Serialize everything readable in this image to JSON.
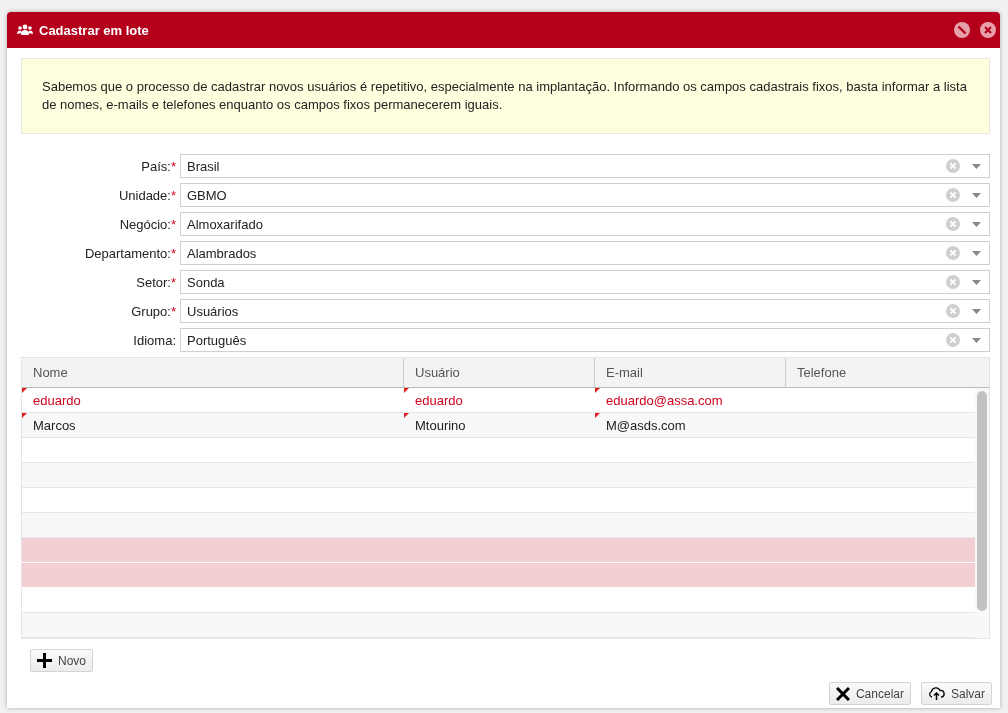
{
  "window": {
    "title": "Cadastrar em lote"
  },
  "notice": "Sabemos que o processo de cadastrar novos usuários é repetitivo, especialmente na implantação. Informando os campos cadastrais fixos, basta informar a lista de nomes, e-mails e telefones enquanto os campos fixos permanecerem iguais.",
  "fields": [
    {
      "label": "País:",
      "required_mark": "*",
      "value": "Brasil"
    },
    {
      "label": "Unidade:",
      "required_mark": "*",
      "value": "GBMO"
    },
    {
      "label": "Negócio:",
      "required_mark": "*",
      "value": "Almoxarifado"
    },
    {
      "label": "Departamento:",
      "required_mark": "*",
      "value": "Alambrados"
    },
    {
      "label": "Setor:",
      "required_mark": "*",
      "value": "Sonda"
    },
    {
      "label": "Grupo:",
      "required_mark": "*",
      "value": "Usuários"
    },
    {
      "label": "Idioma:",
      "value": "Português"
    }
  ],
  "table": {
    "columns": [
      "Nome",
      "Usuário",
      "E-mail",
      "Telefone"
    ],
    "rows": [
      {
        "invalid": true,
        "selected": false,
        "cells": [
          {
            "text": "eduardo",
            "dirty": true
          },
          {
            "text": "eduardo",
            "dirty": true
          },
          {
            "text": "eduardo@assa.com",
            "dirty": true
          }
        ]
      },
      {
        "invalid": false,
        "selected": false,
        "cells": [
          {
            "text": "Marcos",
            "dirty": true
          },
          {
            "text": "Mtourino",
            "dirty": true
          },
          {
            "text": "M@asds.com",
            "dirty": true
          }
        ]
      },
      {
        "selected": false
      },
      {
        "selected": false
      },
      {
        "selected": false
      },
      {
        "selected": false
      },
      {
        "selected": true
      },
      {
        "selected": true
      },
      {
        "selected": false
      },
      {
        "selected": false
      }
    ]
  },
  "add_button": "Novo",
  "buttons": [
    {
      "kind": "cancel",
      "label": "Cancelar"
    },
    {
      "kind": "save",
      "label": "Salvar"
    }
  ]
}
